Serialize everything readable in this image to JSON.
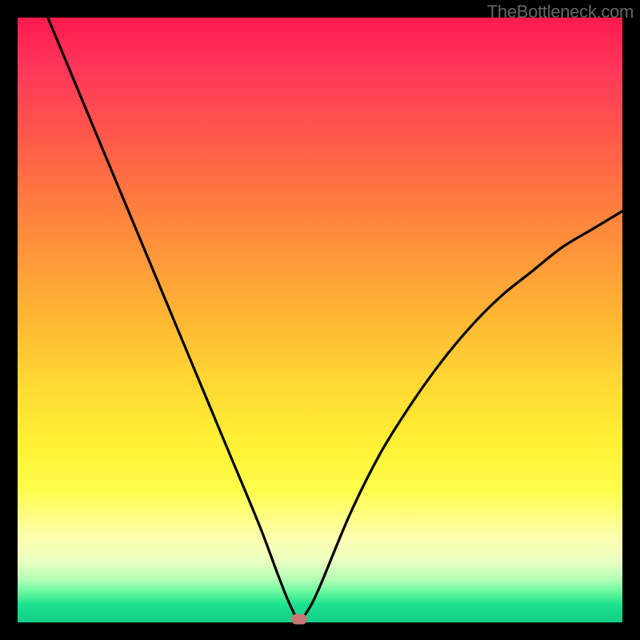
{
  "watermark": "TheBottleneck.com",
  "colors": {
    "frame": "#000000",
    "curve": "#000000",
    "marker": "#c97772",
    "gradient_top": "#ff1a4d",
    "gradient_bottom": "#0fcf87"
  },
  "chart_data": {
    "type": "line",
    "title": "",
    "xlabel": "",
    "ylabel": "",
    "xlim": [
      0,
      100
    ],
    "ylim": [
      0,
      100
    ],
    "series": [
      {
        "name": "curve",
        "x": [
          5,
          10,
          15,
          20,
          25,
          30,
          35,
          40,
          43,
          45,
          46.5,
          48,
          50,
          55,
          60,
          65,
          70,
          75,
          80,
          85,
          90,
          95,
          100
        ],
        "y": [
          100,
          88,
          76,
          64,
          52,
          40,
          28,
          16,
          8,
          3,
          0.5,
          2,
          6,
          18,
          28,
          36,
          43,
          49,
          54,
          58,
          62,
          65,
          68
        ]
      }
    ],
    "marker": {
      "x": 46.5,
      "y": 0.5
    },
    "annotations": [],
    "legend": false,
    "grid": false
  }
}
